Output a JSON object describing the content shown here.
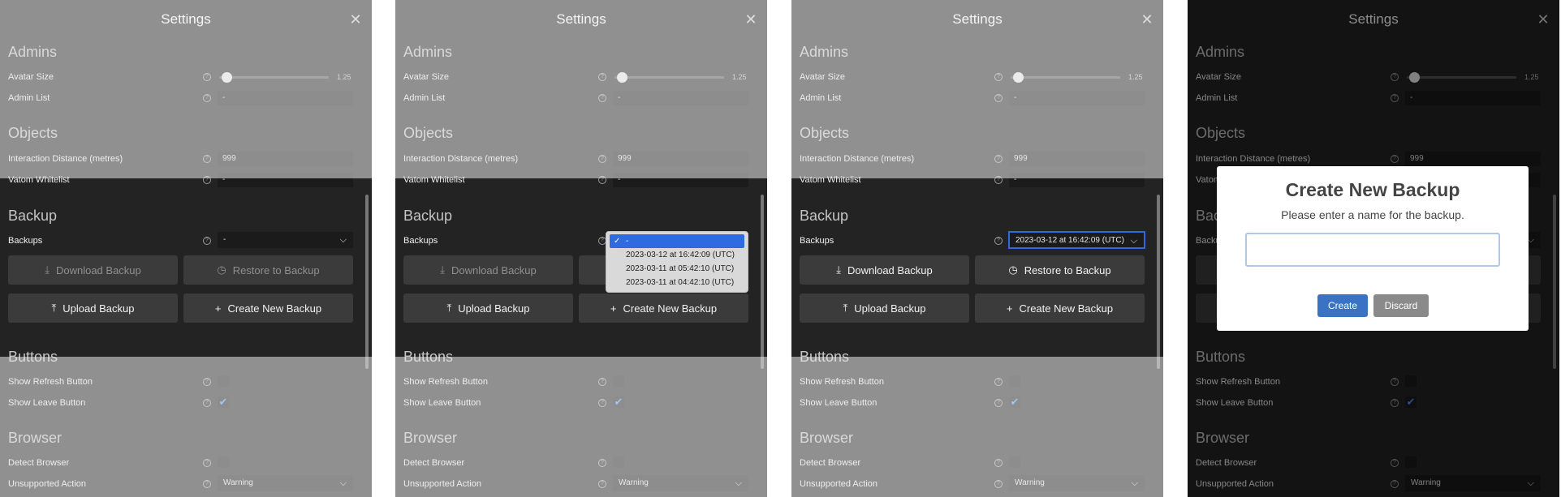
{
  "title": "Settings",
  "admins": {
    "title": "Admins",
    "avatar_size": {
      "label": "Avatar Size",
      "value": "1.25",
      "fraction": 0.06
    },
    "admin_list": {
      "label": "Admin List",
      "value": "-"
    }
  },
  "objects": {
    "title": "Objects",
    "interaction_distance": {
      "label": "Interaction Distance (metres)",
      "value": "999"
    },
    "vatom_whitelist": {
      "label": "Vatom Whitelist",
      "value": "-"
    }
  },
  "backup": {
    "title": "Backup",
    "backups_label": "Backups",
    "selected_default": "-",
    "selected_chosen": "2023-03-12 at 16:42:09 (UTC)",
    "options": [
      "-",
      "2023-03-12 at 16:42:09 (UTC)",
      "2023-03-11 at 05:42:10 (UTC)",
      "2023-03-11 at 04:42:10 (UTC)"
    ],
    "download_label": "Download Backup",
    "restore_label": "Restore to Backup",
    "upload_label": "Upload Backup",
    "create_label": "Create New Backup"
  },
  "buttons": {
    "title": "Buttons",
    "show_refresh": {
      "label": "Show Refresh Button",
      "checked": false
    },
    "show_leave": {
      "label": "Show Leave Button",
      "checked": true
    }
  },
  "browser": {
    "title": "Browser",
    "detect_browser": {
      "label": "Detect Browser",
      "checked": false
    },
    "unsupported_action": {
      "label": "Unsupported Action",
      "value": "Warning"
    }
  },
  "modal": {
    "title": "Create New Backup",
    "message": "Please enter a name for the backup.",
    "input_value": "",
    "create_label": "Create",
    "discard_label": "Discard"
  },
  "colors": {
    "accent": "#2f6bdf",
    "create_button": "#3a72c4",
    "discard_button": "#8a8a8a",
    "checkmark": "#4d93ff"
  },
  "icons": {
    "close": "close-icon",
    "help": "help-icon",
    "download": "download-icon",
    "restore": "clock-icon",
    "upload": "upload-icon",
    "create": "plus-icon",
    "chevron": "chevron-down-icon",
    "check": "check-icon"
  }
}
